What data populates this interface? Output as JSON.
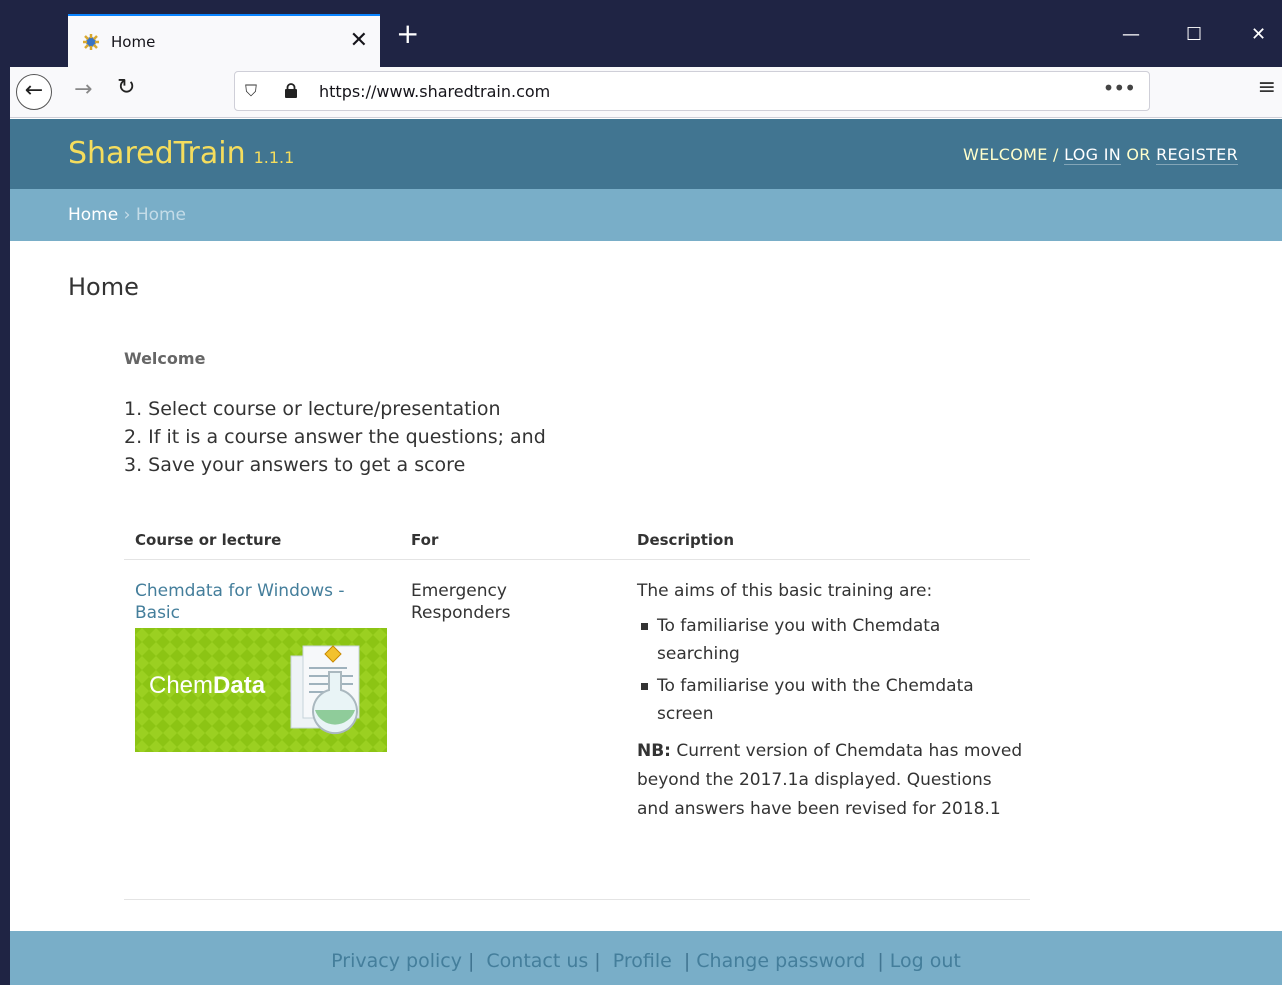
{
  "browser": {
    "tab_title": "Home",
    "url": "https://www.sharedtrain.com",
    "close_glyph": "✕",
    "newtab_glyph": "+",
    "more_glyph": "•••",
    "menu_glyph": "≡"
  },
  "header": {
    "brand": "SharedTrain",
    "version": "1.1.1",
    "welcome": "WELCOME / ",
    "login": "LOG IN",
    "or": " OR ",
    "register": "REGISTER"
  },
  "breadcrumbs": {
    "home_link": "Home",
    "separator": " › ",
    "current": "Home"
  },
  "main": {
    "title": "Home",
    "welcome_heading": "Welcome",
    "steps": [
      "1. Select course or lecture/presentation",
      "2. If it is a course answer the questions; and",
      "3. Save your answers to get a score"
    ],
    "table": {
      "headers": [
        "Course or lecture",
        "For",
        "Description"
      ],
      "rows": [
        {
          "course": "Chemdata for Windows - Basic",
          "image_text_plain": "Chem",
          "image_text_bold": "Data",
          "for": "Emergency Responders",
          "desc_intro": "The aims of this basic training are:",
          "desc_bullets": [
            "To familiarise you with Chemdata searching",
            "To familiarise you with the Chemdata screen"
          ],
          "note_label": "NB:",
          "note_text": " Current version of Chemdata has moved beyond the 2017.1a displayed. Questions and answers have been revised for 2018.1"
        }
      ]
    }
  },
  "footer": {
    "links": [
      "Privacy policy",
      "Contact us",
      "Profile",
      "Change password",
      "Log out"
    ]
  },
  "colors": {
    "header_bg": "#417591",
    "breadcrumb_bg": "#79aec8",
    "brand": "#f5dd5d",
    "link": "#447e9b"
  }
}
